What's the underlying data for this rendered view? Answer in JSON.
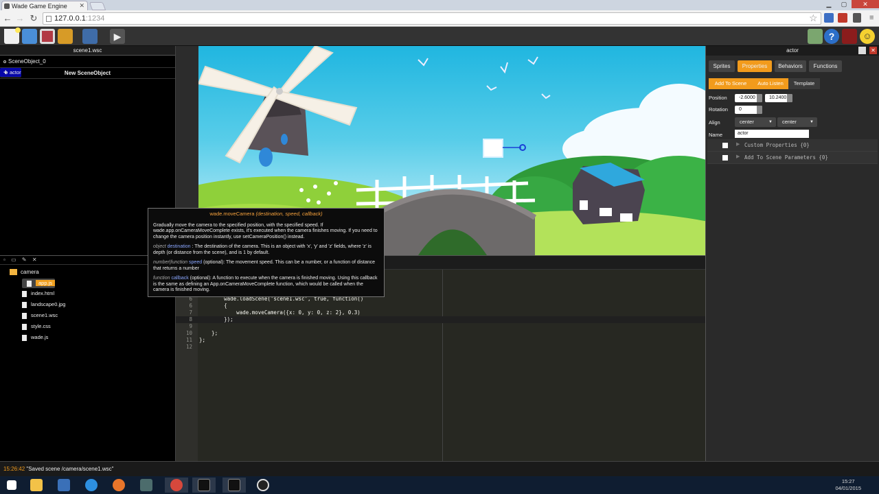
{
  "browser": {
    "tab_title": "Wade Game Engine",
    "url_host": "127.0.0.1",
    "url_port": ":1234"
  },
  "toolbar": {
    "help_label": "?",
    "play_label": "▶"
  },
  "scene_panel": {
    "title": "scene1.wsc",
    "objects": [
      "SceneObject_0",
      "actor"
    ],
    "new_object_label": "New SceneObject"
  },
  "file_panel": {
    "folder": "camera",
    "files": [
      "app.js",
      "index.html",
      "landscape0.jpg",
      "scene1.wsc",
      "style.css",
      "wade.js"
    ]
  },
  "editor": {
    "lines": [
      {
        "n": "6",
        "code": "        wade.loadScene('scene1.wsc', true, function()"
      },
      {
        "n": "6",
        "code": "        {"
      },
      {
        "n": "7",
        "code": "            wade.moveCamera({x: 0, y: 0, z: 2}, 0.3)"
      },
      {
        "n": "8",
        "code": "        });"
      },
      {
        "n": "9",
        "code": ""
      },
      {
        "n": "10",
        "code": "    };"
      },
      {
        "n": "11",
        "code": "};"
      },
      {
        "n": "12",
        "code": ""
      }
    ]
  },
  "tooltip": {
    "signature": "wade.moveCamera",
    "params": "(destination, speed, callback)",
    "desc": "Gradually move the camera to the specified position, with the specified speed. If wade.app.onCameraMoveComplete exists, it's executed when the camera finishes moving. If you need to change the camera position instantly, use setCameraPosition() instead.",
    "p1_type": "object",
    "p1_name": "destination",
    "p1_desc": ": The destination of the camera. This is an object with 'x', 'y' and 'z' fields, where 'z' is depth (or distance from the scene), and is 1 by default.",
    "p2_type": "number|function",
    "p2_name": "speed",
    "p2_desc": "(optional): The movement speed. This can be a number, or a function of distance that returns a number",
    "p3_type": "function",
    "p3_name": "callback",
    "p3_desc": "(optional): A function to execute when the camera is finished moving. Using this callback is the same as defining an App.onCameraMoveComplete function, which would be called when the camera is finished moving."
  },
  "properties": {
    "title": "actor",
    "tabs": [
      "Sprites",
      "Properties",
      "Behaviors",
      "Functions"
    ],
    "active_tab": "Properties",
    "buttons": [
      "Add To Scene",
      "Auto Listen",
      "Template"
    ],
    "position_label": "Position",
    "pos_x": "-2.6000",
    "pos_y": "10.2400",
    "rotation_label": "Rotation",
    "rotation": "0",
    "align_label": "Align",
    "align_h": "center",
    "align_v": "center",
    "name_label": "Name",
    "name": "actor",
    "custom_props": "Custom Properties {0}",
    "scene_params": "Add To Scene Parameters {0}"
  },
  "status": {
    "time": "15:26:42",
    "message": " \"Saved scene /camera/scene1.wsc\""
  },
  "taskbar": {
    "clock_time": "15:27",
    "clock_date": "04/01/2015"
  },
  "colors": {
    "accent": "#f29b1c",
    "selection": "#0707a8",
    "sky": "#20b6e0"
  }
}
